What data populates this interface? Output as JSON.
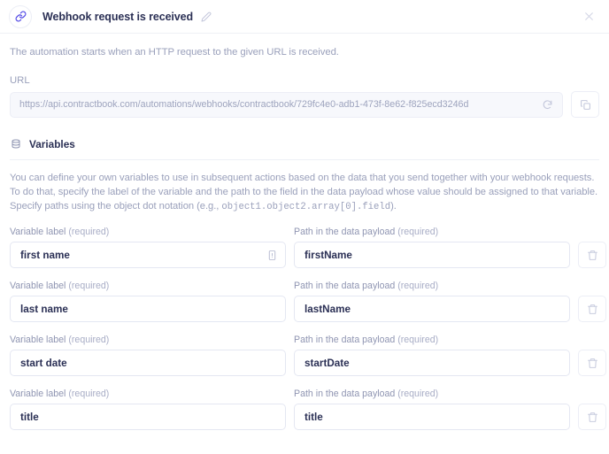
{
  "header": {
    "icon": "link-icon",
    "title": "Webhook request is received",
    "edit_icon": "pencil-icon",
    "close_icon": "close-icon"
  },
  "description": "The automation starts when an HTTP request to the given URL is received.",
  "url_section": {
    "label": "URL",
    "value": "https://api.contractbook.com/automations/webhooks/contractbook/729fc4e0-adb1-473f-8e62-f825ecd3246d",
    "refresh_icon": "refresh-icon",
    "copy_icon": "copy-icon"
  },
  "variables": {
    "icon": "database-icon",
    "title": "Variables",
    "paragraph_1": "You can define your own variables to use in subsequent actions based on the data that you send together with your webhook requests. To do that, specify the label of the variable and the path to the field in the data payload whose value should be assigned to that variable. Specify paths using the object dot notation (e.g., ",
    "paragraph_code": "object1.object2.array[0].field",
    "paragraph_2": ").",
    "label_variable": "Variable label",
    "label_path": "Path in the data payload",
    "required_suffix": "(required)",
    "delete_icon": "trash-icon",
    "tag_icon": "insert-variable-icon",
    "rows": [
      {
        "label": "first name",
        "path": "firstName",
        "has_tag_icon": true
      },
      {
        "label": "last name",
        "path": "lastName",
        "has_tag_icon": false
      },
      {
        "label": "start date",
        "path": "startDate",
        "has_tag_icon": false
      },
      {
        "label": "title",
        "path": "title",
        "has_tag_icon": false
      }
    ]
  },
  "colors": {
    "accent": "#4f46e5",
    "text": "#2b3055",
    "muted": "#9aa0bb",
    "border": "#eceef6"
  }
}
